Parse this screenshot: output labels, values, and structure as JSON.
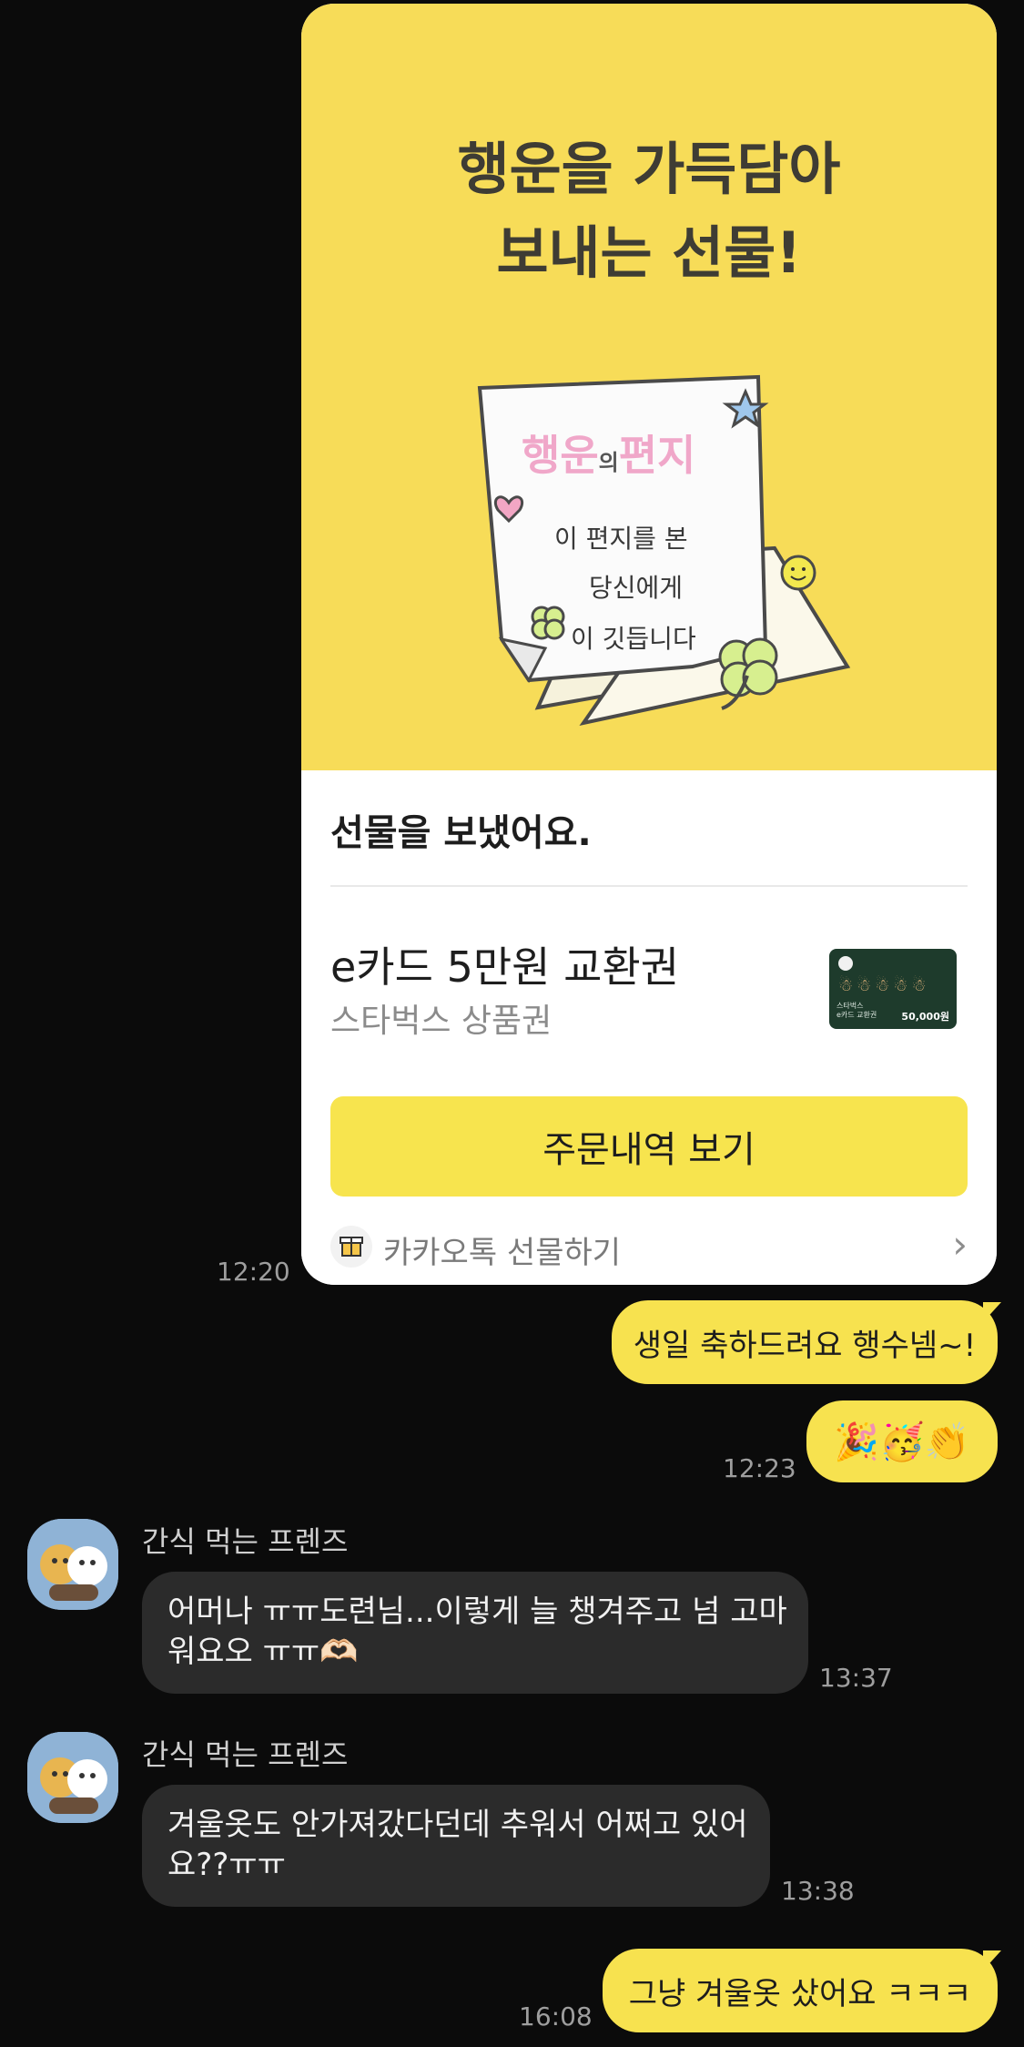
{
  "gift_card": {
    "hero_title_line1": "행운을 가득담아",
    "hero_title_line2": "보내는 선물!",
    "letter": {
      "title_part1": "행운",
      "title_small": "의",
      "title_part2": "편지",
      "line1": "이 편지를 본",
      "line2": "당신에게",
      "line3": "이 깃듭니다"
    },
    "sent_label": "선물을 보냈어요.",
    "product_name": "e카드 5만원 교환권",
    "product_brand": "스타벅스 상품권",
    "thumb_caption": "스타벅스\ne카드 교환권",
    "thumb_price": "50,000원",
    "order_button": "주문내역 보기",
    "footer_label": "카카오톡 선물하기",
    "time": "12:20"
  },
  "messages": [
    {
      "id": "m1",
      "from": "me",
      "text": "생일 축하드려요 행수넴~!"
    },
    {
      "id": "m2",
      "from": "me",
      "emoji": "🎉🥳👏",
      "time": "12:23"
    },
    {
      "id": "m3",
      "from": "other",
      "sender": "간식 먹는 프렌즈",
      "line1": "어머나 ㅠㅠ도련님...이렇게 늘 챙겨주고 넘 고마",
      "line2": "워요오 ㅠㅠ🫶🏻",
      "time": "13:37"
    },
    {
      "id": "m4",
      "from": "other",
      "sender": "간식 먹는 프렌즈",
      "line1": "겨울옷도 안가져갔다던데 추워서 어쩌고 있어",
      "line2": "요??ㅠㅠ",
      "time": "13:38"
    },
    {
      "id": "m5",
      "from": "me",
      "text": "그냥 겨울옷 샀어요 ㅋㅋㅋ",
      "time": "16:08"
    }
  ],
  "colors": {
    "background": "#0b0b0b",
    "my_bubble": "#f7e24f",
    "other_bubble": "#2b2b2b",
    "hero_yellow": "#f7dc58"
  }
}
